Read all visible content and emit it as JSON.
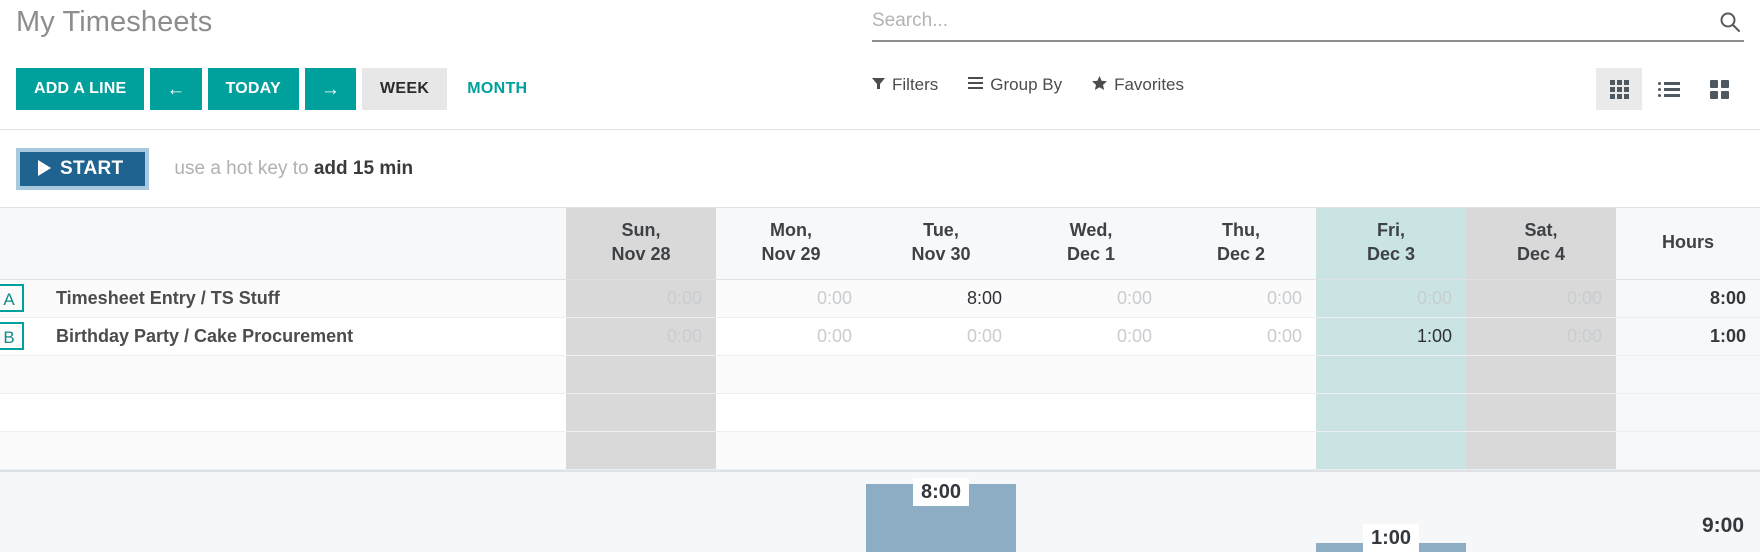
{
  "header": {
    "title": "My Timesheets",
    "buttons": {
      "add_line": "ADD A LINE",
      "prev": "←",
      "today": "TODAY",
      "next": "→",
      "week": "WEEK",
      "month": "MONTH"
    },
    "search": {
      "placeholder": "Search...",
      "value": "",
      "icon": "search-icon"
    },
    "filter_menu": [
      {
        "label": "Filters",
        "icon": "filter-icon",
        "glyph": "▼"
      },
      {
        "label": "Group By",
        "icon": "hamburger-icon",
        "glyph": "☰"
      },
      {
        "label": "Favorites",
        "icon": "star-icon",
        "glyph": "★"
      }
    ],
    "views": [
      {
        "name": "grid-view",
        "active": true
      },
      {
        "name": "list-view",
        "active": false
      },
      {
        "name": "kanban-view",
        "active": false
      }
    ]
  },
  "timer": {
    "start_label": "START",
    "play_icon": "play-icon",
    "hint_prefix": "use a hot key to ",
    "hint_strong": "add 15 min"
  },
  "colors": {
    "accent_teal": "#00a09d",
    "start_blue": "#1f6391",
    "start_border": "#a9c9de",
    "today_highlight": "#c9e4e2",
    "weekend": "#d9d9d9",
    "bar": "#8cadc4"
  },
  "grid": {
    "columns": [
      {
        "day": "Sun,",
        "date": "Nov 28",
        "kind": "weekend"
      },
      {
        "day": "Mon,",
        "date": "Nov 29",
        "kind": "normal"
      },
      {
        "day": "Tue,",
        "date": "Nov 30",
        "kind": "normal"
      },
      {
        "day": "Wed,",
        "date": "Dec 1",
        "kind": "normal"
      },
      {
        "day": "Thu,",
        "date": "Dec 2",
        "kind": "normal"
      },
      {
        "day": "Fri,",
        "date": "Dec 3",
        "kind": "today"
      },
      {
        "day": "Sat,",
        "date": "Dec 4",
        "kind": "weekend"
      }
    ],
    "hours_header": "Hours",
    "rows": [
      {
        "badge": "A",
        "name": "Timesheet Entry / TS Stuff",
        "values": [
          "0:00",
          "0:00",
          "8:00",
          "0:00",
          "0:00",
          "0:00",
          "0:00"
        ],
        "total": "8:00"
      },
      {
        "badge": "B",
        "name": "Birthday Party / Cake Procurement",
        "values": [
          "0:00",
          "0:00",
          "0:00",
          "0:00",
          "0:00",
          "1:00",
          "0:00"
        ],
        "total": "1:00"
      }
    ],
    "blank_rows": 3
  },
  "chart_data": {
    "type": "bar",
    "categories": [
      "Sun, Nov 28",
      "Mon, Nov 29",
      "Tue, Nov 30",
      "Wed, Dec 1",
      "Thu, Dec 2",
      "Fri, Dec 3",
      "Sat, Dec 4"
    ],
    "values": [
      0,
      0,
      8,
      0,
      0,
      1,
      0
    ],
    "labels": [
      "",
      "",
      "8:00",
      "",
      "",
      "1:00",
      ""
    ],
    "title": "",
    "xlabel": "",
    "ylabel": "Hours",
    "ylim": [
      0,
      8
    ],
    "grand_total": "9:00",
    "grid": false,
    "legend": "none"
  }
}
